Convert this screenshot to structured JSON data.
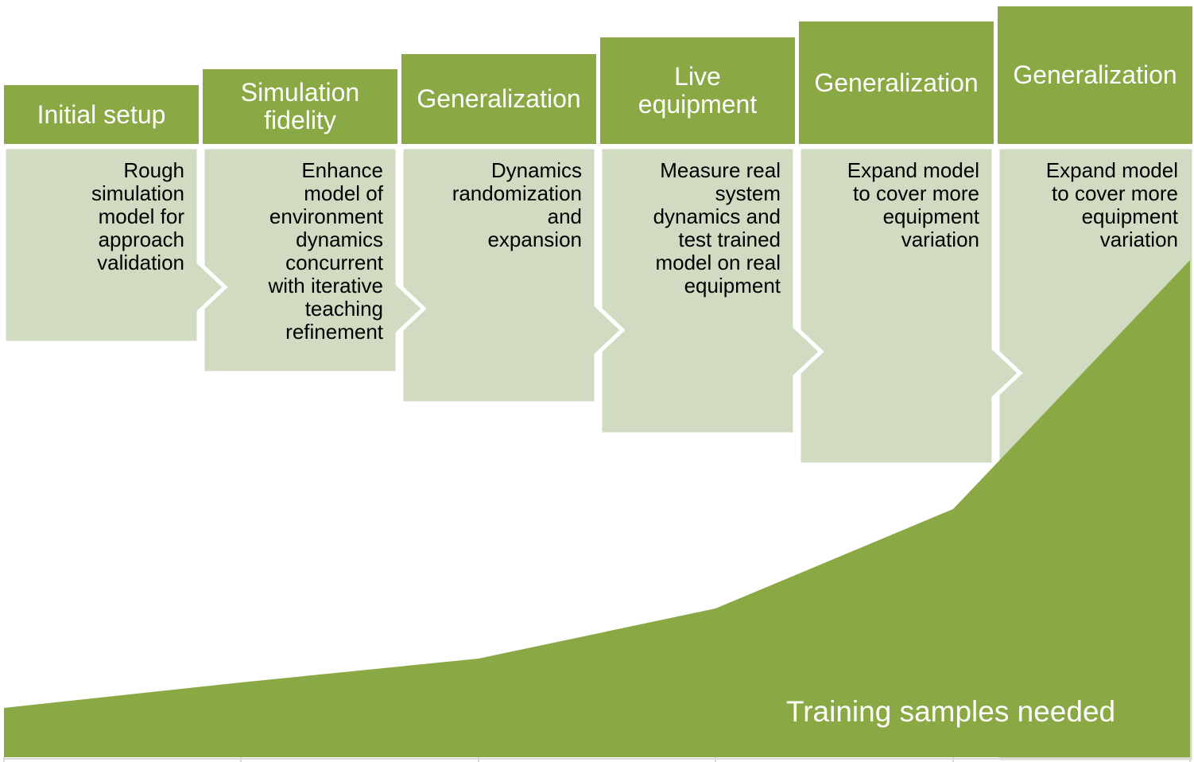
{
  "colors": {
    "header": "#8aa843",
    "body": "#d0dbc2",
    "area": "#8aa843",
    "axis": "#d9d9d9"
  },
  "stages": [
    {
      "title": [
        "Initial setup"
      ],
      "description": [
        "Rough",
        "simulation",
        "model for",
        "approach",
        "validation"
      ]
    },
    {
      "title": [
        "Simulation",
        "fidelity"
      ],
      "description": [
        "Enhance",
        "model of",
        "environment",
        "dynamics",
        "concurrent",
        "with iterative",
        "teaching",
        "refinement"
      ]
    },
    {
      "title": [
        "Generalization"
      ],
      "description": [
        "Dynamics",
        "randomization",
        "and",
        "expansion"
      ]
    },
    {
      "title": [
        "Live",
        "equipment"
      ],
      "description": [
        "Measure real",
        "system",
        "dynamics and",
        "test trained",
        "model on real",
        "equipment"
      ]
    },
    {
      "title": [
        "Generalization"
      ],
      "description": [
        "Expand model",
        "to cover more",
        "equipment",
        "variation"
      ]
    },
    {
      "title": [
        "Generalization"
      ],
      "description": [
        "Expand model",
        "to cover more",
        "equipment",
        "variation"
      ]
    }
  ],
  "area_label": "Training samples needed"
}
